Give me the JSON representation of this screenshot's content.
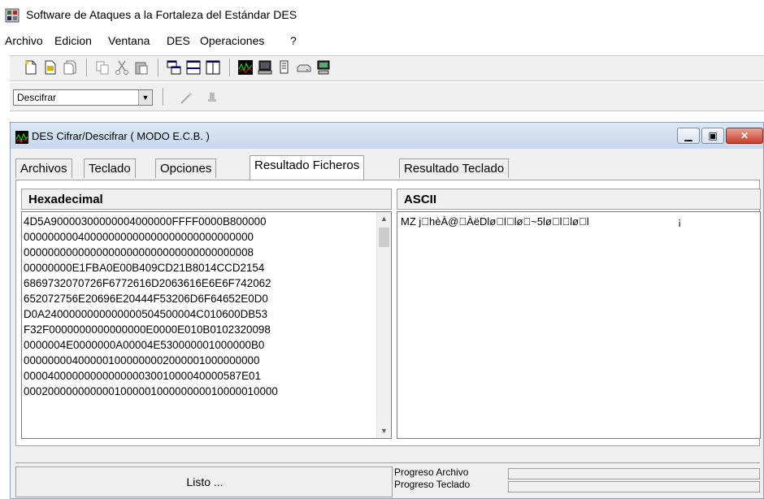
{
  "app": {
    "title": "Software de Ataques a la Fortaleza del Estándar DES"
  },
  "menu": [
    "Archivo",
    "Edicion",
    "Ventana",
    "DES",
    "Operaciones",
    "?"
  ],
  "toolbar": {
    "mode_select_value": "Descifrar",
    "icons": [
      "new-icon",
      "open-icon",
      "save-icon",
      "copy-icon",
      "cut-icon",
      "paste-icon",
      "tile-icon",
      "cascade-icon",
      "arrange-icon",
      "des-icon",
      "monitor-icon",
      "document-icon",
      "drive-icon",
      "computer-icon"
    ]
  },
  "window": {
    "title": "DES Cifrar/Descifrar ( MODO E.C.B. )",
    "tabs": [
      "Archivos",
      "Teclado",
      "Opciones",
      "Resultado Ficheros",
      "Resultado Teclado"
    ],
    "active_tab": "Resultado Ficheros",
    "hex_header": "Hexadecimal",
    "ascii_header": "ASCII",
    "hex_lines": [
      "4D5A90000300000004000000FFFF0000B800000",
      "00000000040000000000000000000000000000",
      "00000000000000000000000000000000000008",
      "00000000E1FBA0E00B409CD21B8014CCD2154",
      "6869732070726F6772616D2063616E6E6F742062",
      "652072756E20696E20444F53206D6F64652E0D0",
      "D0A2400000000000000504500004C010600DB53",
      "F32F0000000000000000E0000E010B0102320098",
      "0000004E0000000A00004E530000001000000B0",
      "000000004000001000000002000001000000000",
      "000040000000000000003001000040000587E01",
      "000200000000000100000100000000010000010000"
    ],
    "ascii_text": "MZ j\u0000hèÀ@\u0000ÀëDlø\u0000l\u0000lø\u0000~5lø\u0000l\u0000lø\u0000l",
    "ascii_extra": "¡"
  },
  "status": {
    "message": "Listo ...",
    "progress_archivo_label": "Progreso Archivo",
    "progress_teclado_label": "Progreso Teclado",
    "progress_archivo": 0,
    "progress_teclado": 0
  }
}
